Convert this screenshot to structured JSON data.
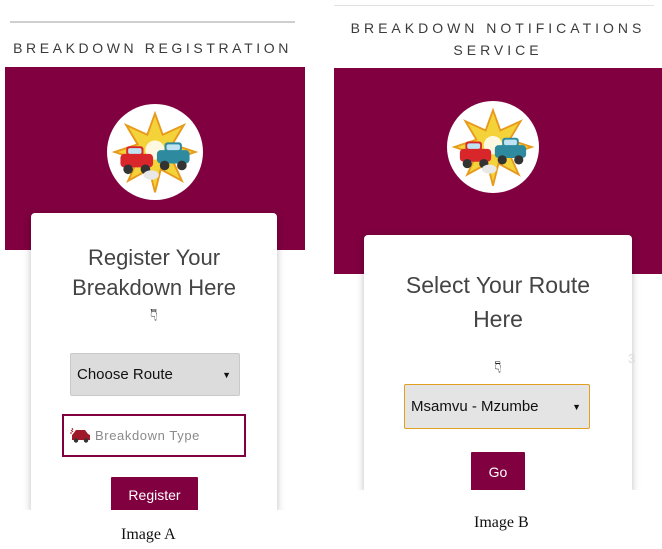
{
  "image_a": {
    "app_title": "BREAKDOWN REGISTRATION",
    "heading": "Register Your Breakdown Here",
    "hand_icon": "pointing-down-icon",
    "route_select": {
      "selected": "Choose Route"
    },
    "breakdown_type": {
      "placeholder": "Breakdown Type",
      "icon": "car-breakdown-icon"
    },
    "submit_label": "Register",
    "caption": "Image A"
  },
  "image_b": {
    "app_title": "BREAKDOWN NOTIFICATIONS SERVICE",
    "heading": "Select Your Route Here",
    "hand_icon": "pointing-down-icon",
    "route_select": {
      "selected": "Msamvu - Mzumbe"
    },
    "submit_label": "Go",
    "stray_text": "3",
    "caption": "Image B"
  },
  "colors": {
    "brand": "#800040",
    "select_bg": "#dcdcdc",
    "focus_border": "#e0a020"
  }
}
